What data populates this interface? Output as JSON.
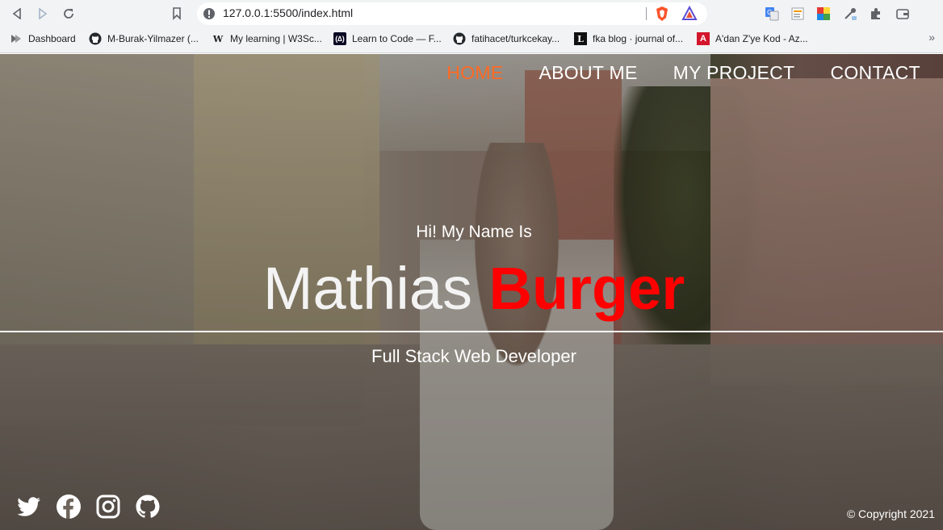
{
  "browser": {
    "url": "127.0.0.1:5500/index.html",
    "bookmarks": [
      {
        "label": "Dashboard",
        "icon": "dashboard-icon"
      },
      {
        "label": "M-Burak-Yilmazer (...",
        "icon": "github-icon"
      },
      {
        "label": "My learning | W3Sc...",
        "icon": "w3schools-icon"
      },
      {
        "label": "Learn to Code — F...",
        "icon": "freecodecamp-icon"
      },
      {
        "label": "fatihacet/turkcekay...",
        "icon": "github-icon"
      },
      {
        "label": "fka blog · journal of...",
        "icon": "fka-blog-icon"
      },
      {
        "label": "A'dan Z'ye Kod - Az...",
        "icon": "adan-zye-kod-icon"
      }
    ],
    "more_bookmarks": "»"
  },
  "nav": {
    "home": "HOME",
    "about": "ABOUT ME",
    "project": "MY PROJECT",
    "contact": "CONTACT"
  },
  "hero": {
    "greeting": "Hi! My Name Is",
    "first_name": "Mathias",
    "last_name": "Burger",
    "role": "Full Stack Web Developer"
  },
  "footer": {
    "social": [
      "twitter-icon",
      "facebook-icon",
      "instagram-icon",
      "github-icon"
    ],
    "copyright": "© Copyright 2021"
  },
  "colors": {
    "accent_nav": "#ff6a24",
    "accent_name": "#ff0000"
  }
}
